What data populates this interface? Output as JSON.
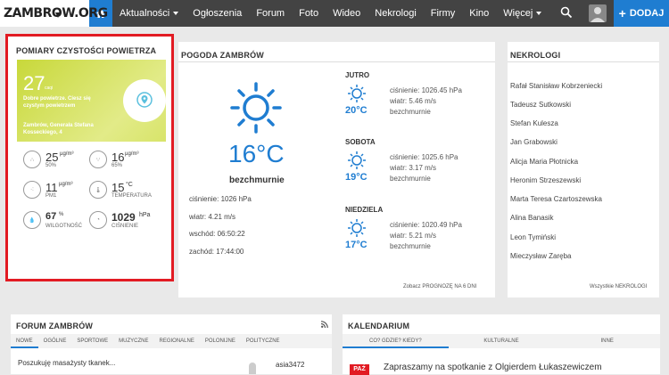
{
  "nav": {
    "logo": "ZAMBROW.ORG",
    "items": [
      "Aktualności",
      "Ogłoszenia",
      "Forum",
      "Foto",
      "Wideo",
      "Nekrologi",
      "Firmy",
      "Kino",
      "Więcej"
    ],
    "add_label": "DODAJ"
  },
  "air": {
    "title": "POMIARY CZYSTOŚCI POWIETRZA",
    "caqi_value": "27",
    "caqi_unit": "caqi",
    "quality_text": "Dobre powietrze. Ciesz się czystym powietrzem",
    "location": "Zambrów, Generała Stefana Kosseckiego, 4",
    "pm10": {
      "value": "25",
      "unit": "µg/m³",
      "percent": "50%",
      "label": "PM10"
    },
    "pm25": {
      "value": "16",
      "unit": "µg/m³",
      "percent": "65%",
      "label": "PM2.5"
    },
    "pm1": {
      "value": "11",
      "unit": "µg/m³",
      "label": "PM1"
    },
    "temp": {
      "value": "15",
      "unit": "°C",
      "label": "TEMPERATURA"
    },
    "humidity": {
      "value": "67",
      "unit": "%",
      "label": "WILGOTNOŚĆ"
    },
    "pressure": {
      "value": "1029",
      "unit": "hPa",
      "label": "CIŚNIENIE"
    }
  },
  "weather": {
    "title": "POGODA ZAMBRÓW",
    "temp": "16°C",
    "desc": "bezchmurnie",
    "pressure": "ciśnienie: 1026 hPa",
    "wind": "wiatr: 4.21 m/s",
    "sunrise": "wschód: 06:50:22",
    "sunset": "zachód: 17:44:00",
    "days": [
      {
        "name": "JUTRO",
        "temp": "20°C",
        "pressure": "ciśnienie: 1026.45 hPa",
        "wind": "wiatr: 5.46 m/s",
        "desc": "bezchmurnie"
      },
      {
        "name": "SOBOTA",
        "temp": "19°C",
        "pressure": "ciśnienie: 1025.6 hPa",
        "wind": "wiatr: 3.17 m/s",
        "desc": "bezchmurnie"
      },
      {
        "name": "NIEDZIELA",
        "temp": "17°C",
        "pressure": "ciśnienie: 1020.49 hPa",
        "wind": "wiatr: 5.21 m/s",
        "desc": "bezchmurnie"
      }
    ],
    "footer": "Zobacz PROGNOZĘ NA 6 DNI"
  },
  "obituaries": {
    "title": "NEKROLOGI",
    "names": [
      "Rafał Stanisław Kobrzeniecki",
      "Tadeusz Sutkowski",
      "Stefan Kulesza",
      "Jan Grabowski",
      "Alicja Maria Płotnicka",
      "Heronim Strzeszewski",
      "Marta Teresa Czartoszewska",
      "Alina Banasik",
      "Leon Tymiński",
      "Mieczysław Zaręba"
    ],
    "footer": "Wszystkie NEKROLOGI"
  },
  "forum": {
    "title": "FORUM ZAMBRÓW",
    "tabs": [
      "NOWE",
      "OGÓLNE",
      "SPORTOWE",
      "MUZYCZNE",
      "REGIONALNE",
      "POLONIJNE",
      "POLITYCZNE"
    ],
    "post_title": "Poszukuję masażysty tkanek...",
    "post_author": "asia3472"
  },
  "calendar": {
    "title": "KALENDARIUM",
    "tabs": [
      "CO? GDZIE? KIEDY?",
      "KULTURALNE",
      "INNE"
    ],
    "badge": "PAŹ",
    "event": "Zapraszamy na spotkanie z Olgierdem Łukaszewiczem"
  },
  "colors": {
    "accent": "#1f7dd1",
    "nav_bg": "#434343",
    "highlight_border": "#e21b23",
    "air_good": "#c8d83a"
  }
}
